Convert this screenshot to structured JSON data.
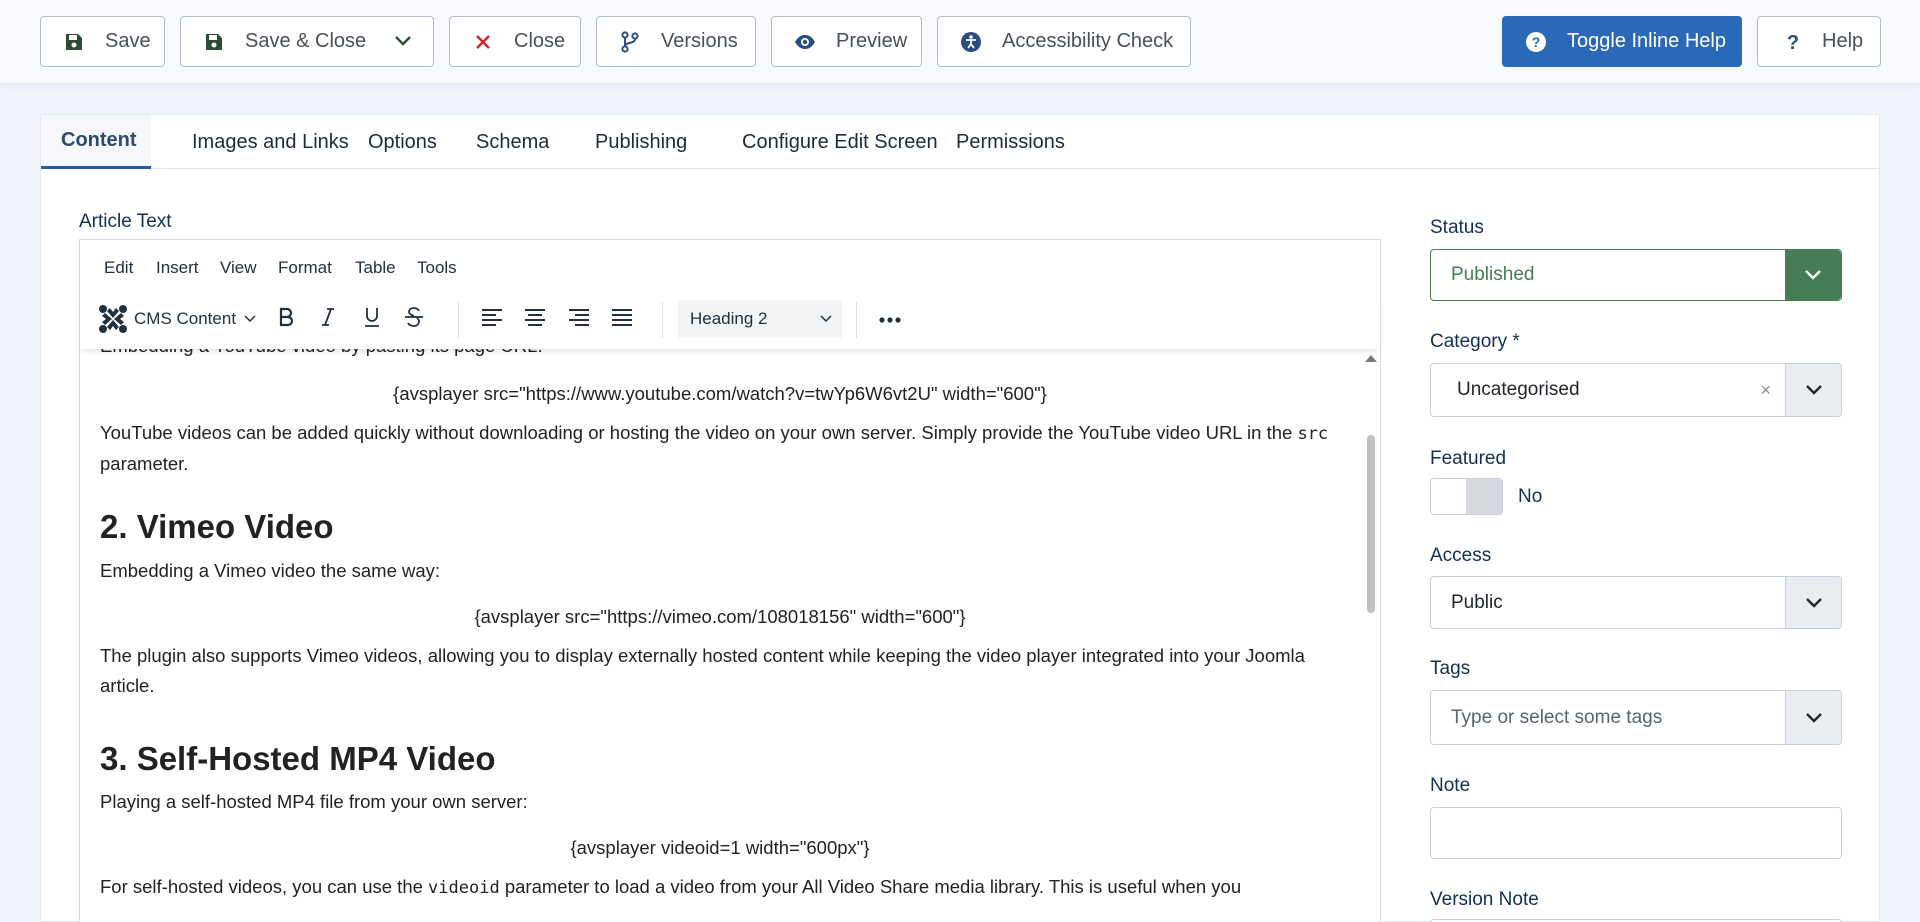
{
  "toolbar": {
    "save": "Save",
    "save_close": "Save & Close",
    "close": "Close",
    "versions": "Versions",
    "preview": "Preview",
    "accessibility": "Accessibility Check",
    "toggle_help": "Toggle Inline Help",
    "help": "Help"
  },
  "tabs": [
    "Content",
    "Images and Links",
    "Options",
    "Schema",
    "Publishing",
    "Configure Edit Screen",
    "Permissions"
  ],
  "editor": {
    "label": "Article Text",
    "menu": [
      "Edit",
      "Insert",
      "View",
      "Format",
      "Table",
      "Tools"
    ],
    "cms_content": "CMS Content",
    "block_format": "Heading 2"
  },
  "content": {
    "line_top": "Embedding a YouTube video by pasting its page URL:",
    "code1": "{avsplayer src=\"https://www.youtube.com/watch?v=twYp6W6vt2U\" width=\"600\"}",
    "p1a": "YouTube videos can be added quickly without downloading or hosting the video on your own server. Simply provide the YouTube video URL in the ",
    "p1_code": "src",
    "p1b": " parameter.",
    "h2": "2. Vimeo Video",
    "p2": "Embedding a Vimeo video the same way:",
    "code2": "{avsplayer src=\"https://vimeo.com/108018156\" width=\"600\"}",
    "p3": "The plugin also supports Vimeo videos, allowing you to display externally hosted content while keeping the video player integrated into your Joomla article.",
    "h3": "3. Self-Hosted MP4 Video",
    "p4": "Playing a self-hosted MP4 file from your own server:",
    "code3": "{avsplayer videoid=1 width=\"600px\"}",
    "p5a": "For self-hosted videos, you can use the ",
    "p5_code": "videoid",
    "p5b": " parameter to load a video from your All Video Share media library. This is useful when you"
  },
  "sidebar": {
    "status_label": "Status",
    "status_value": "Published",
    "category_label": "Category *",
    "category_value": "Uncategorised",
    "featured_label": "Featured",
    "featured_value": "No",
    "access_label": "Access",
    "access_value": "Public",
    "tags_label": "Tags",
    "tags_placeholder": "Type or select some tags",
    "note_label": "Note",
    "version_note_label": "Version Note"
  },
  "colors": {
    "primary": "#2a69b8",
    "status_green": "#457d54",
    "save_icon": "#2b4d35",
    "close_icon": "#c52827"
  }
}
